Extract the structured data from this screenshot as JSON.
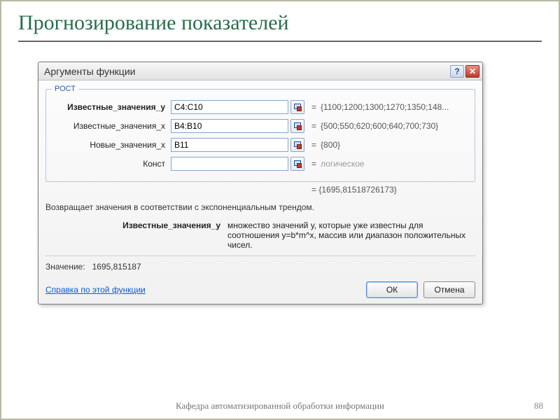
{
  "slide": {
    "title": "Прогнозирование  показателей",
    "footer": "Кафедра автоматизированной обработки информации",
    "page_number": "88"
  },
  "dialog": {
    "title": "Аргументы функции",
    "group_label": "РОСТ",
    "args": [
      {
        "label": "Известные_значения_y",
        "bold": true,
        "value": "C4:C10",
        "result": "{1100;1200;1300;1270;1350;148...",
        "muted": false
      },
      {
        "label": "Известные_значения_x",
        "bold": false,
        "value": "B4:B10",
        "result": "{500;550;620;600;640;700;730}",
        "muted": false
      },
      {
        "label": "Новые_значения_x",
        "bold": false,
        "value": "B11",
        "result": "{800}",
        "muted": false
      },
      {
        "label": "Конст",
        "bold": false,
        "value": "",
        "result": "логическое",
        "muted": true
      }
    ],
    "overall_result": "= {1695,81518726173}",
    "description": "Возвращает значения в соответствии с экспоненциальным трендом.",
    "param_help_label": "Известные_значения_y",
    "param_help_text": "множество значений y, которые уже известны для соотношения y=b*m^x, массив или диапазон положительных чисел.",
    "value_label": "Значение:",
    "value_number": "1695,815187",
    "help_link": "Справка по этой функции",
    "ok_label": "ОК",
    "cancel_label": "Отмена"
  }
}
